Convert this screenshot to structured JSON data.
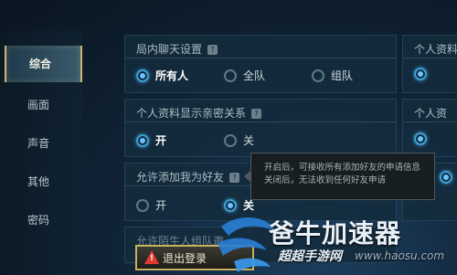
{
  "sidebar": {
    "items": [
      {
        "label": "综合",
        "active": true
      },
      {
        "label": "画面"
      },
      {
        "label": "声音"
      },
      {
        "label": "其他"
      },
      {
        "label": "密码"
      }
    ]
  },
  "sections": [
    {
      "title": "局内聊天设置",
      "options": [
        {
          "label": "所有人",
          "selected": true
        },
        {
          "label": "全队"
        },
        {
          "label": "组队"
        }
      ]
    },
    {
      "title": "个人资料显示亲密关系",
      "options": [
        {
          "label": "开",
          "selected": true
        },
        {
          "label": "关"
        }
      ]
    },
    {
      "title": "允许添加我为好友",
      "options": [
        {
          "label": "开"
        },
        {
          "label": "关",
          "selected": true
        }
      ]
    },
    {
      "title": "允许陌生人组队邀"
    }
  ],
  "right_sections": [
    {
      "title": "个人资料"
    },
    {
      "title": "个人资"
    }
  ],
  "tooltip": {
    "line1": "开启后，可接收所有添加好友的申请信息",
    "line2": "关闭后，无法收到任何好友申请"
  },
  "logout": {
    "label": "退出登录",
    "icon": "warning-icon"
  },
  "watermark": {
    "brand": "爸牛加速器",
    "site": "超超手游网",
    "url": "www.haosu.com"
  },
  "colors": {
    "accent": "#3f9fd5",
    "gold": "#c9b677",
    "warning": "#e13a2e"
  }
}
